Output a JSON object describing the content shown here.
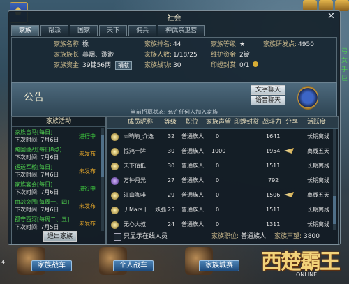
{
  "window": {
    "title": "社会"
  },
  "tabs": [
    {
      "label": "家族",
      "active": true
    },
    {
      "label": "帮派"
    },
    {
      "label": "国家"
    },
    {
      "label": "天下"
    },
    {
      "label": "佣兵"
    },
    {
      "label": "神武亲卫营"
    }
  ],
  "family_info": {
    "name_k": "家族名称:",
    "name_v": "橡",
    "leader_k": "家族族长:",
    "leader_v": "暮烟、渺渺",
    "funds_k": "家族资金:",
    "funds_v": "39锭56两",
    "donate_label": "捐献",
    "rank_k": "家族排名:",
    "rank_v": "44",
    "members_k": "家族人数:",
    "members_v": "1/18/25",
    "power_k": "家族战功:",
    "power_v": "30",
    "level_k": "家族等级:",
    "level_v": "★",
    "upkeep_k": "维护资金:",
    "upkeep_v": "2锭",
    "seal_k": "印螳封赏:",
    "seal_v": "0/1",
    "seal_icon": "gold-coin",
    "research_k": "家族研发点:",
    "research_v": "4950"
  },
  "notice": {
    "label": "公告",
    "text_chat": "文字聊天",
    "voice_chat": "语音聊天",
    "recruit_status": "当前招募状态: 允许任何人加入家族"
  },
  "activity": {
    "title": "家族活动",
    "items": [
      {
        "name": "家族盲马[每日]",
        "time": "下次时间: 7月6日",
        "status": "进行中",
        "state": "go"
      },
      {
        "name": "跨国挑战[每日8点]",
        "time": "下次时间: 7月6日",
        "status": "未发布",
        "state": "no"
      },
      {
        "name": "运送军粮[每日]",
        "time": "下次时间: 7月6日",
        "status": "未发布",
        "state": "no"
      },
      {
        "name": "家族宴会[每日]",
        "time": "下次时间: 7月6日",
        "status": "进行中",
        "state": "go"
      },
      {
        "name": "血战突围[每周一、四]",
        "time": "下次时间: 7月6日",
        "status": "未发布",
        "state": "no"
      },
      {
        "name": "孤守西河[每周二、五]",
        "time": "下次时间: 7月5日",
        "status": "未发布",
        "state": "no"
      }
    ],
    "exit_button": "退出家族"
  },
  "members": {
    "headers": [
      "成员昵称",
      "等级",
      "职位",
      "家族声望",
      "印螳封赏",
      "战斗力",
      "分享",
      "活跃度"
    ],
    "rows": [
      {
        "name": "☆晌晌_介逸",
        "level": "32",
        "position": "普通族人",
        "prestige": "0",
        "seal": "",
        "power": "1641",
        "share": false,
        "activity": "长期离线",
        "icon": "sun-profession-icon"
      },
      {
        "name": "惊鸿一眸",
        "level": "30",
        "position": "普通族人",
        "prestige": "1000",
        "seal": "",
        "power": "1954",
        "share": true,
        "activity": "离线五天",
        "icon": "sun-profession-icon"
      },
      {
        "name": "天下佰抵",
        "level": "30",
        "position": "普通族人",
        "prestige": "0",
        "seal": "",
        "power": "1511",
        "share": false,
        "activity": "长期离线",
        "icon": "sun-profession-icon"
      },
      {
        "name": "万钟月光",
        "level": "27",
        "position": "普通族人",
        "prestige": "0",
        "seal": "",
        "power": "792",
        "share": false,
        "activity": "长期离线",
        "icon": "mage-profession-icon"
      },
      {
        "name": "江山咖啡",
        "level": "29",
        "position": "普通族人",
        "prestige": "0",
        "seal": "",
        "power": "1506",
        "share": true,
        "activity": "离线五天",
        "icon": "sun-profession-icon"
      },
      {
        "name": "丿Mars丨....妖弧",
        "level": "25",
        "position": "普通族人",
        "prestige": "0",
        "seal": "",
        "power": "1511",
        "share": false,
        "activity": "长期离线",
        "icon": "sun-profession-icon"
      },
      {
        "name": "无心大叔",
        "level": "24",
        "position": "普通族人",
        "prestige": "0",
        "seal": "",
        "power": "1311",
        "share": false,
        "activity": "长期离线",
        "icon": "sun-profession-icon"
      }
    ],
    "online_only_label": "只显示在线人员",
    "my_position_k": "家族职位:",
    "my_position_v": "普通族人",
    "my_prestige_k": "家族声望:",
    "my_prestige_v": "3800"
  },
  "bottom": {
    "family_war": "家族战车",
    "personal_war": "个人战车",
    "city_race": "家族城赛",
    "logo": "西楚霸王",
    "logo_sub": "ONLINE",
    "left_num": "4"
  },
  "side_text": [
    "弓",
    "女",
    "手",
    "巨"
  ]
}
